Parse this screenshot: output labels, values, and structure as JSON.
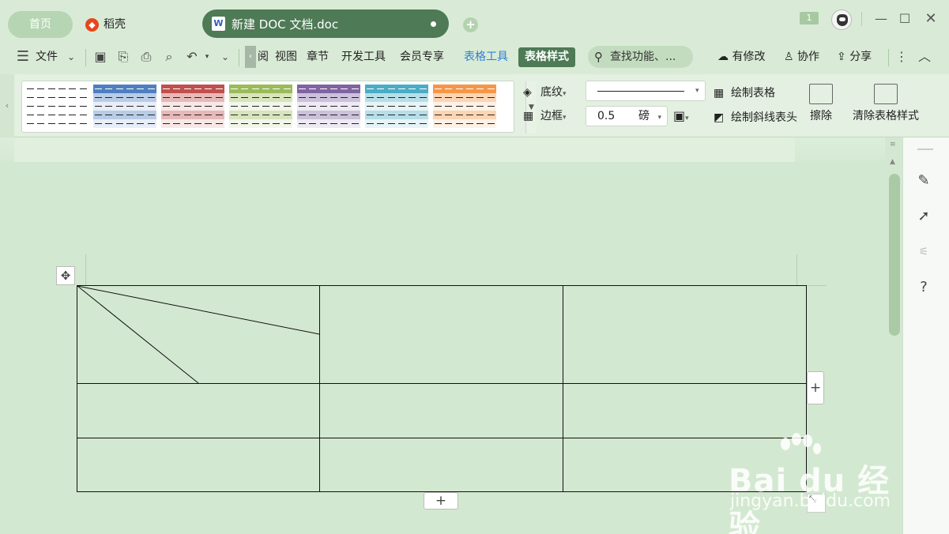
{
  "tabs": {
    "home": "首页",
    "daoke": "稻壳",
    "document": "新建 DOC 文档.doc",
    "notification_count": "1"
  },
  "menu": {
    "file": "文件",
    "items": [
      "阅",
      "视图",
      "章节",
      "开发工具",
      "会员专享"
    ],
    "table_tools": "表格工具",
    "table_style": "表格样式",
    "search_placeholder": "查找功能、...",
    "has_changes": "有修改",
    "collaborate": "协作",
    "share": "分享"
  },
  "ribbon": {
    "shading": "底纹",
    "border": "边框",
    "line_width_value": "0.5",
    "line_width_unit": "磅",
    "draw_table": "绘制表格",
    "draw_diagonal_header": "绘制斜线表头",
    "erase": "擦除",
    "clear_table_style": "清除表格样式",
    "style_colors": [
      "#ffffff",
      "#4f7fc0",
      "#c0504d",
      "#9bbb59",
      "#8064a2",
      "#4bacc6",
      "#f79646"
    ]
  },
  "watermark": {
    "main": "Bai du 经验",
    "sub": "jingyan.baidu.com"
  }
}
